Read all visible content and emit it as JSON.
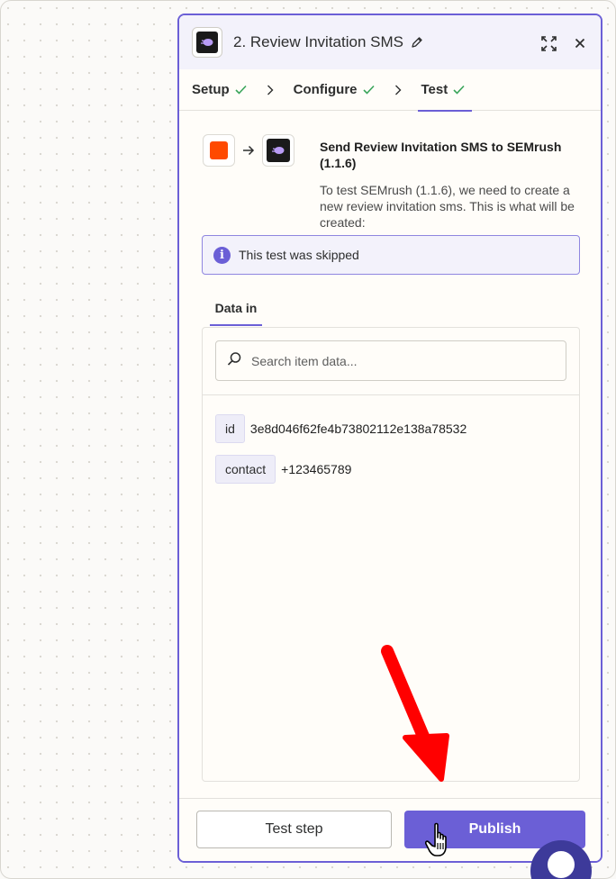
{
  "panel": {
    "title": "2. Review Invitation SMS",
    "app_icon": "semrush-logo-icon"
  },
  "tabs": [
    {
      "label": "Setup",
      "status": "complete"
    },
    {
      "label": "Configure",
      "status": "complete"
    },
    {
      "label": "Test",
      "status": "complete",
      "active": true
    }
  ],
  "step": {
    "title": "Send Review Invitation SMS to SEMrush (1.1.6)",
    "description": "To test SEMrush (1.1.6), we need to create a new review invitation sms. This is what will be created:"
  },
  "notice": {
    "text": "This test was skipped"
  },
  "data_in": {
    "tab_label": "Data in",
    "search_placeholder": "Search item data...",
    "items": [
      {
        "key": "id",
        "value": "3e8d046f62fe4b73802112e138a78532"
      },
      {
        "key": "contact",
        "value": "+123465789"
      }
    ]
  },
  "footer": {
    "test_label": "Test step",
    "publish_label": "Publish"
  },
  "colors": {
    "accent": "#6b5fd6",
    "success": "#3aa55b",
    "annotation_arrow": "#ff0000",
    "trigger_orange": "#ff4a00"
  }
}
